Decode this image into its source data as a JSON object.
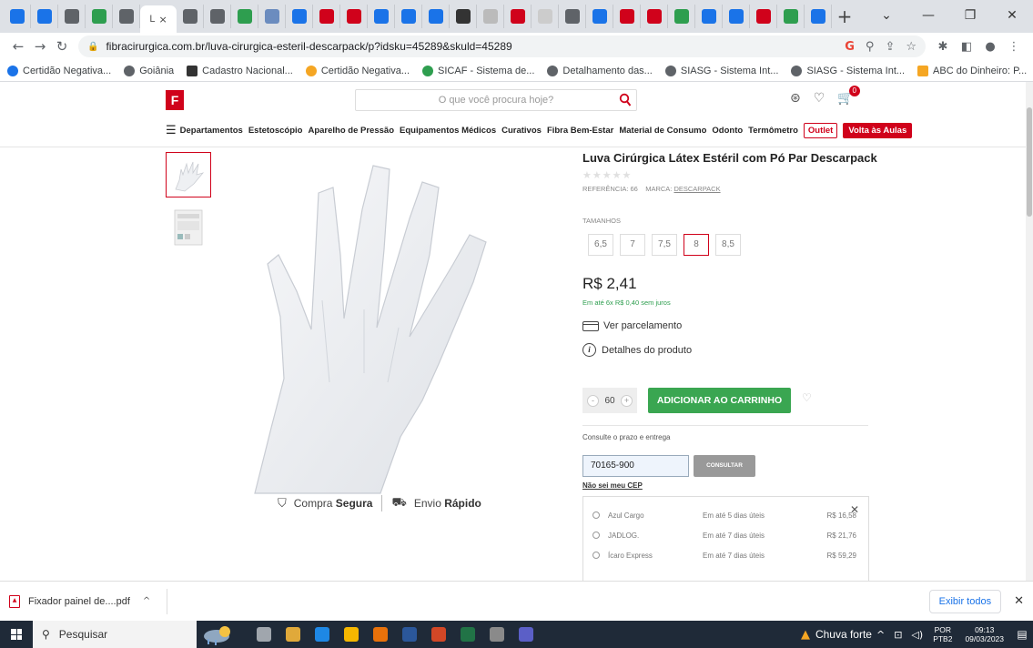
{
  "browser": {
    "active_tab_letter": "L",
    "tab_close": "×",
    "new_tab": "+",
    "win_min": "—",
    "win_max": "❐",
    "win_close": "✕",
    "tab_favicon_colors": [
      "#1a73e8",
      "#1a73e8",
      "#5f6368",
      "#2e9e4f",
      "#5f6368",
      "#5f6368",
      "#5f6368",
      "#2e9e4f",
      "#6b8cbf",
      "#1a73e8",
      "#d0021b",
      "#d0021b",
      "#1a73e8",
      "#1a73e8",
      "#1a73e8",
      "#333333",
      "#bbbbbb",
      "#d0021b",
      "#cccccc",
      "#5f6368",
      "#1a73e8",
      "#d0021b",
      "#d0021b",
      "#2e9e4f",
      "#1a73e8",
      "#1a73e8",
      "#d0021b",
      "#2e9e4f",
      "#1a73e8"
    ],
    "url": "fibracirurgica.com.br/luva-cirurgica-esteril-descarpack/p?idsku=45289&skuld=45289",
    "bookmarks": [
      {
        "label": "Certidão Negativa...",
        "color": "#1a73e8"
      },
      {
        "label": "Goiânia",
        "color": "#5f6368"
      },
      {
        "label": "Cadastro Nacional...",
        "color": "#333333"
      },
      {
        "label": "Certidão Negativa...",
        "color": "#f5a623"
      },
      {
        "label": "SICAF - Sistema de...",
        "color": "#2e9e4f"
      },
      {
        "label": "Detalhamento das...",
        "color": "#5f6368"
      },
      {
        "label": "SIASG - Sistema Int...",
        "color": "#5f6368"
      },
      {
        "label": "SIASG - Sistema Int...",
        "color": "#5f6368"
      },
      {
        "label": "ABC do Dinheiro: P...",
        "color": "#f5a623"
      }
    ],
    "bookmarks_more": "»"
  },
  "site": {
    "logo_letter": "F",
    "search_placeholder": "O que você procura hoje?",
    "cart_count": "0",
    "nav": {
      "first": "Departamentos",
      "items": [
        "Estetoscópio",
        "Aparelho de Pressão",
        "Equipamentos Médicos",
        "Curativos",
        "Fibra Bem-Estar",
        "Material de Consumo",
        "Odonto",
        "Termômetro"
      ],
      "outlet": "Outlet",
      "volta": "Volta às Aulas"
    }
  },
  "product": {
    "title": "Luva Cirúrgica Látex Estéril com Pó Par Descarpack",
    "stars": "★★★★★",
    "ref_label": "REFERÊNCIA: 66",
    "brand_label": "MARCA:",
    "brand": "DESCARPACK",
    "sizes_label": "TAMANHOS",
    "sizes": [
      "6,5",
      "7",
      "7,5",
      "8",
      "8,5"
    ],
    "selected_size": "8",
    "price": "R$ 2,41",
    "installments": "Em até 6x R$ 0,40 sem juros",
    "parcel_link": "Ver parcelamento",
    "details_link": "Detalhes do produto",
    "qty_minus": "-",
    "qty": "60",
    "qty_plus": "+",
    "add_to_cart": "ADICIONAR AO CARRINHO",
    "trust_1a": "Compra",
    "trust_1b": "Segura",
    "trust_2a": "Envio",
    "trust_2b": "Rápido"
  },
  "shipping": {
    "label": "Consulte o prazo e entrega",
    "cep_value": "70165-900",
    "consult_button": "CONSULTAR",
    "no_cep": "Não sei meu CEP",
    "close": "✕",
    "options": [
      {
        "name": "Azul Cargo",
        "time": "Em até 5 dias úteis",
        "price": "R$ 16,58"
      },
      {
        "name": "JADLOG.",
        "time": "Em até 7 dias úteis",
        "price": "R$ 21,76"
      },
      {
        "name": "Ícaro Express",
        "time": "Em até 7 dias úteis",
        "price": "R$ 59,29"
      }
    ]
  },
  "downloads": {
    "file": "Fixador painel de....pdf",
    "show_all": "Exibir todos"
  },
  "taskbar": {
    "search": "Pesquisar",
    "app_colors": [
      "#a0a6ad",
      "#e0a93a",
      "#1e88e5",
      "#f5b700",
      "#e8710a",
      "#2b579a",
      "#d24726",
      "#217346",
      "#8a8a8a",
      "#5b5fc7"
    ],
    "weather": "Chuva forte",
    "lang_1": "POR",
    "lang_2": "PTB2",
    "time": "09:13",
    "date": "09/03/2023"
  }
}
